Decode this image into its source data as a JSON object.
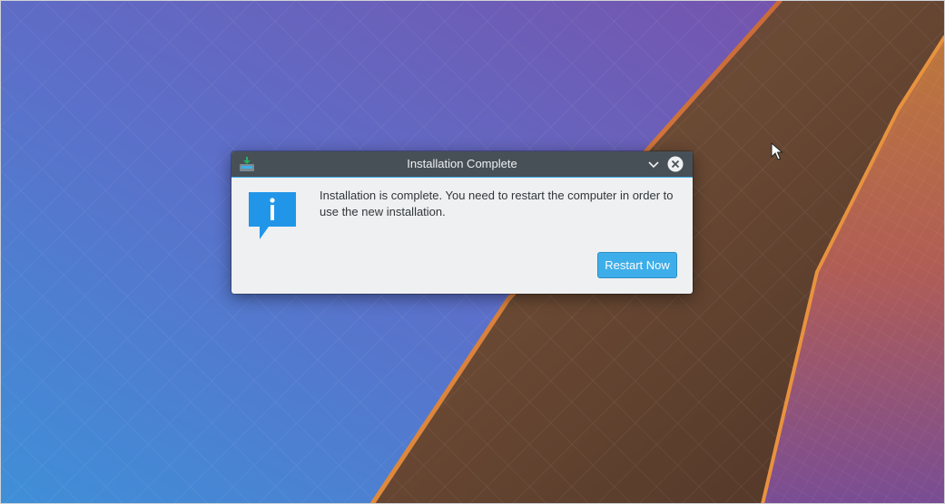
{
  "dialog": {
    "title": "Installation Complete",
    "message": "Installation is complete. You need to restart the computer in order to use the new installation.",
    "restart_button_label": "Restart Now",
    "app_icon": "installer-download-icon",
    "message_icon": "information-icon",
    "titlebar_buttons": [
      "minimize-chevron-icon",
      "close-icon"
    ]
  },
  "colors": {
    "titlebar": "#475057",
    "dialog_background": "#eff0f1",
    "accent": "#3daee9",
    "text": "#31363b"
  }
}
